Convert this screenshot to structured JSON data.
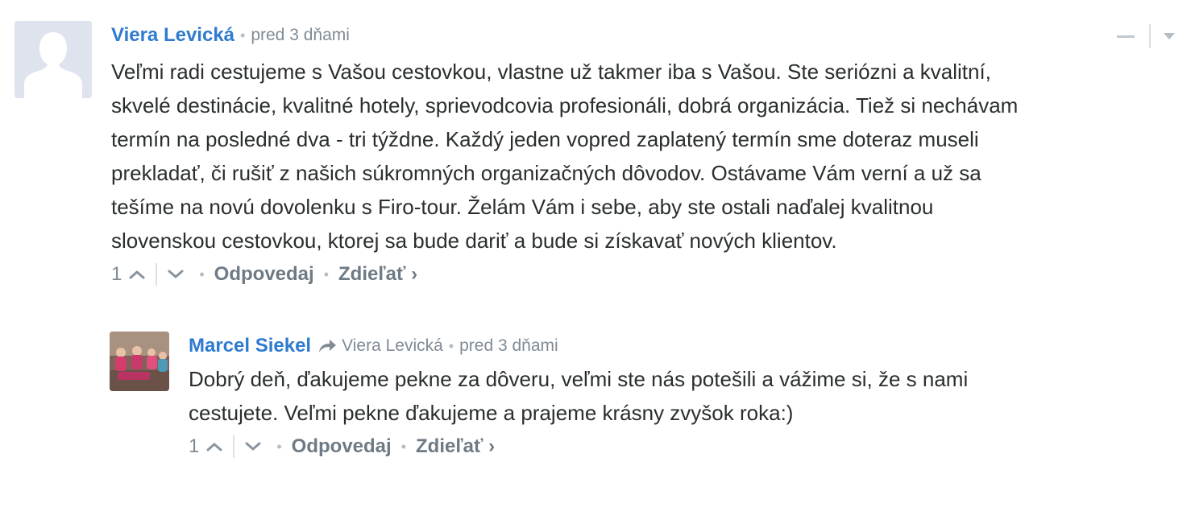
{
  "comments": [
    {
      "author": "Viera Levická",
      "time": "pred 3 dňami",
      "lines": [
        "Veľmi radi cestujeme s Vašou cestovkou, vlastne už takmer iba s Vašou. Ste seriózni a kvalitní,",
        "skvelé destinácie, kvalitné hotely, sprievodcovia profesionáli, dobrá organizácia. Tiež si nechávam",
        "termín na posledné dva - tri týždne. Každý jeden vopred zaplatený termín sme doteraz museli",
        "prekladať, či rušiť z našich súkromných organizačných dôvodov. Ostávame Vám verní a už sa",
        "tešíme na novú dovolenku s Firo-tour. Želám Vám i sebe, aby ste ostali naďalej kvalitnou",
        "slovenskou cestovkou, ktorej sa bude dariť a bude si získavať nových klientov."
      ],
      "votes": "1",
      "reply_label": "Odpovedaj",
      "share_label": "Zdieľať ›"
    },
    {
      "author": "Marcel Siekel",
      "reply_to": "Viera Levická",
      "time": "pred 3 dňami",
      "lines": [
        "Dobrý deň, ďakujeme pekne za dôveru, veľmi ste nás potešili a vážime si, že s nami",
        "cestujete. Veľmi pekne ďakujeme a prajeme krásny zvyšok roka:)"
      ],
      "votes": "1",
      "reply_label": "Odpovedaj",
      "share_label": "Zdieľať ›"
    }
  ],
  "colors": {
    "author": "#2e7bcf",
    "meta": "#7f8b96",
    "text": "#2a2e2e",
    "placeholder_avatar": "#dfe3ee"
  },
  "icons": {
    "avatar_placeholder": "person-silhouette-icon",
    "collapse": "minus-icon",
    "menu": "caret-down-icon",
    "upvote": "chevron-up-icon",
    "downvote": "chevron-down-icon",
    "reply_to": "reply-arrow-icon"
  }
}
